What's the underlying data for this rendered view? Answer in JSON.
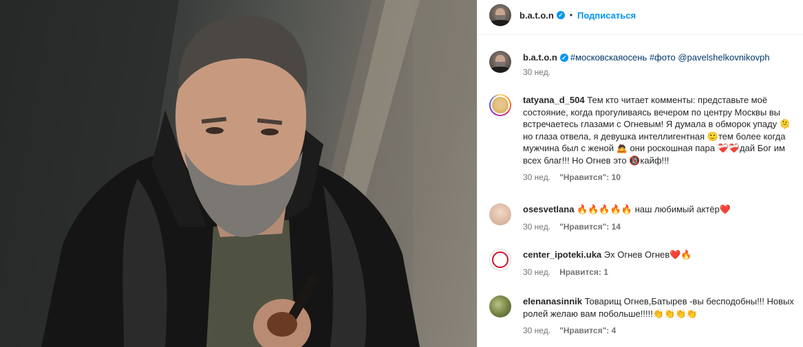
{
  "post": {
    "author": "b.a.t.o.n",
    "verified_mark": "✓",
    "separator": "•",
    "follow_label": "Подписаться"
  },
  "caption": {
    "author": "b.a.t.o.n",
    "text": "#московскаяосень #фото @pavelshelkovnikovph",
    "time": "30 нед."
  },
  "comments": [
    {
      "user": "tatyana_d_504",
      "text": "Тем кто читает комменты: представьте моё состояние, когда прогуливаясь вечером по центру Москвы вы встречаетесь глазами с Огневым! Я думала в обморок упаду 🫠но глаза отвела, я девушка интеллигентная 🙂тем более когда мужчина был с женой 🙇 они роскошная пара ❤️‍🩹❤️‍🩹дай Бог им всех благ!!! Но Огнев это 🔞кайф!!!",
      "time": "30 нед.",
      "likes": "\"Нравится\": 10"
    },
    {
      "user": "osesvetlana",
      "text": "🔥🔥🔥🔥🔥 наш любимый актёр❤️",
      "time": "30 нед.",
      "likes": "\"Нравится\": 14"
    },
    {
      "user": "center_ipoteki.uka",
      "text": "Эх Огнев Огнев❤️🔥",
      "time": "30 нед.",
      "likes": "Нравится: 1"
    },
    {
      "user": "elenanasinnik",
      "text": "Товарищ Огнев,Батырев -вы бесподобны!!! Новых ролей желаю вам побольше!!!!!👏👏👏👏",
      "time": "30 нед.",
      "likes": "\"Нравится\": 4"
    }
  ],
  "colors": {
    "link": "#0095f6",
    "meta_text": "#737373",
    "primary_text": "#262626"
  },
  "icons": {
    "verified": "verified-badge-icon"
  }
}
